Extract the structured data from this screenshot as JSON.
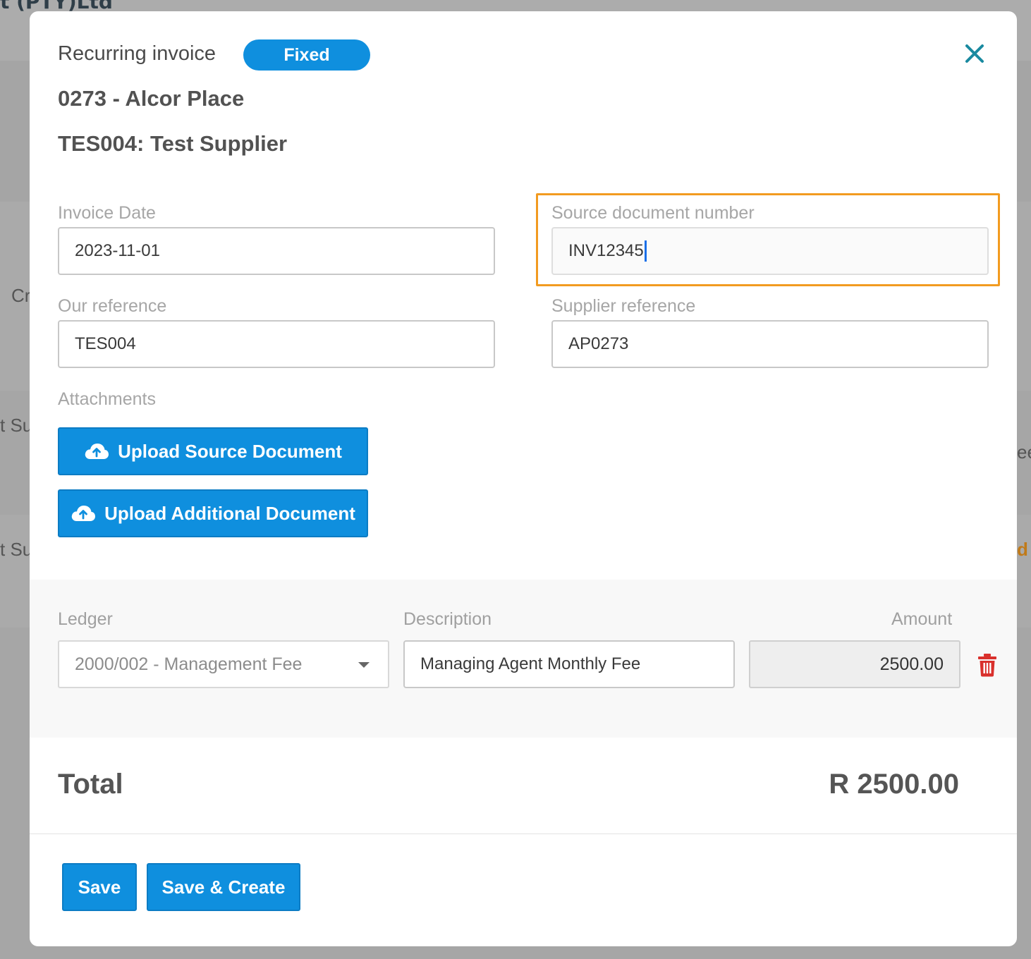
{
  "background": {
    "company_fragment": "t (PTY)Ltd",
    "frag_cr": "Cr",
    "frag_su1": "t Su",
    "frag_su2": "t Su",
    "frag_ee": "ee",
    "frag_d": "d"
  },
  "modal": {
    "title": "Recurring invoice",
    "badge": "Fixed",
    "property": "0273 - Alcor Place",
    "supplier": "TES004: Test Supplier"
  },
  "form": {
    "invoice_date_label": "Invoice Date",
    "invoice_date_value": "2023-11-01",
    "source_doc_label": "Source document number",
    "source_doc_value": "INV12345",
    "our_ref_label": "Our reference",
    "our_ref_value": "TES004",
    "supplier_ref_label": "Supplier reference",
    "supplier_ref_value": "AP0273",
    "attachments_label": "Attachments",
    "upload_source_label": "Upload Source Document",
    "upload_additional_label": "Upload Additional Document"
  },
  "line": {
    "ledger_header": "Ledger",
    "description_header": "Description",
    "amount_header": "Amount",
    "ledger_value": "2000/002 - Management Fee",
    "description_value": "Managing Agent Monthly Fee",
    "amount_value": "2500.00"
  },
  "totals": {
    "label": "Total",
    "value": "R 2500.00"
  },
  "actions": {
    "save": "Save",
    "save_create": "Save & Create"
  },
  "colors": {
    "primary": "#0f8fde",
    "highlight": "#f29b20",
    "close": "#1a8aa0",
    "danger": "#d9302c"
  },
  "icons": {
    "close": "close-icon",
    "upload": "cloud-upload-icon",
    "delete": "trash-icon",
    "dropdown": "chevron-down-icon"
  }
}
